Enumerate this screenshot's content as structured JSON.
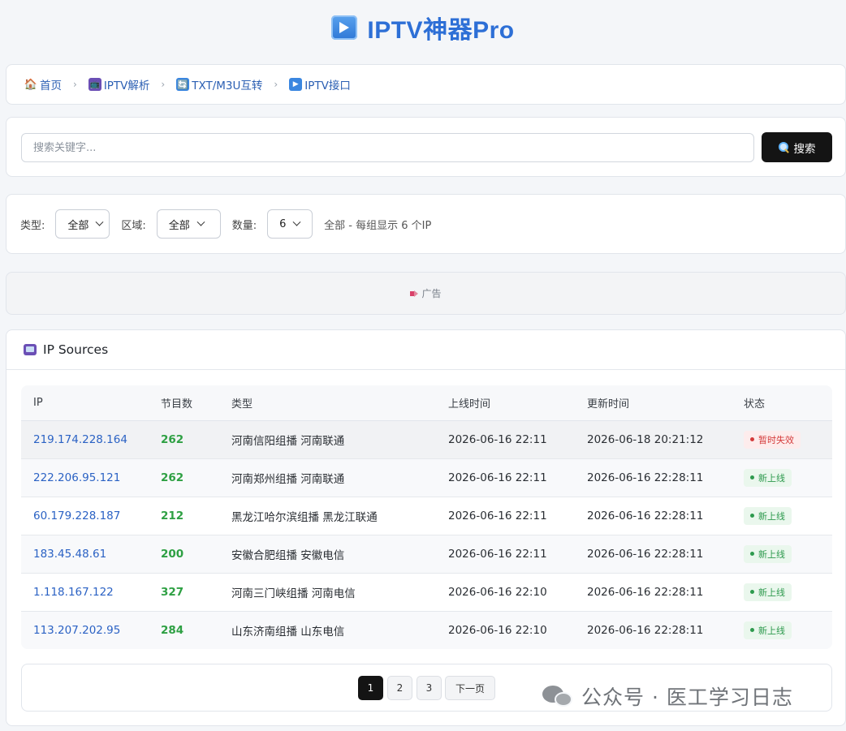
{
  "app": {
    "title": "IPTV神器Pro",
    "icon": "play-button-icon"
  },
  "breadcrumb": [
    {
      "icon": "home-icon",
      "glyph": "🏠",
      "label": "首页"
    },
    {
      "icon": "tv-icon",
      "glyph": "📺",
      "label": "IPTV解析"
    },
    {
      "icon": "sync-icon",
      "glyph": "🔄",
      "label": "TXT/M3U互转"
    },
    {
      "icon": "play-icon",
      "glyph": "▶",
      "label": "IPTV接口"
    }
  ],
  "breadcrumb_separator": "›",
  "search": {
    "placeholder": "搜索关键字...",
    "button_label": "搜索"
  },
  "filters": {
    "type_label": "类型:",
    "type_value": "全部",
    "region_label": "区域:",
    "region_value": "全部",
    "count_label": "数量:",
    "count_value": "6",
    "summary": "全部 - 每组显示 6 个IP"
  },
  "ad": {
    "label": "广告"
  },
  "sources": {
    "title": "IP Sources",
    "columns": [
      "IP",
      "节目数",
      "类型",
      "上线时间",
      "更新时间",
      "状态"
    ],
    "rows": [
      {
        "ip": "219.174.228.164",
        "count": "262",
        "type": "河南信阳组播 河南联通",
        "online": "2026-06-16 22:11",
        "updated": "2026-06-18 20:21:12",
        "status": "暂时失效",
        "status_kind": "bad"
      },
      {
        "ip": "222.206.95.121",
        "count": "262",
        "type": "河南郑州组播 河南联通",
        "online": "2026-06-16 22:11",
        "updated": "2026-06-16 22:28:11",
        "status": "新上线",
        "status_kind": "ok"
      },
      {
        "ip": "60.179.228.187",
        "count": "212",
        "type": "黑龙江哈尔滨组播 黑龙江联通",
        "online": "2026-06-16 22:11",
        "updated": "2026-06-16 22:28:11",
        "status": "新上线",
        "status_kind": "ok"
      },
      {
        "ip": "183.45.48.61",
        "count": "200",
        "type": "安徽合肥组播 安徽电信",
        "online": "2026-06-16 22:11",
        "updated": "2026-06-16 22:28:11",
        "status": "新上线",
        "status_kind": "ok"
      },
      {
        "ip": "1.118.167.122",
        "count": "327",
        "type": "河南三门峡组播 河南电信",
        "online": "2026-06-16 22:10",
        "updated": "2026-06-16 22:28:11",
        "status": "新上线",
        "status_kind": "ok"
      },
      {
        "ip": "113.207.202.95",
        "count": "284",
        "type": "山东济南组播 山东电信",
        "online": "2026-06-16 22:10",
        "updated": "2026-06-16 22:28:11",
        "status": "新上线",
        "status_kind": "ok"
      }
    ]
  },
  "pagination": {
    "pages": [
      "1",
      "2",
      "3"
    ],
    "active": "1",
    "next_label": "下一页"
  },
  "watermark": {
    "text": "公众号 · 医工学习日志"
  },
  "colors": {
    "accent": "#2d6fd6",
    "link": "#2b62c4",
    "count": "#2ea043",
    "ok": "#2e9a4e",
    "bad": "#d43b3b",
    "button": "#141414"
  }
}
